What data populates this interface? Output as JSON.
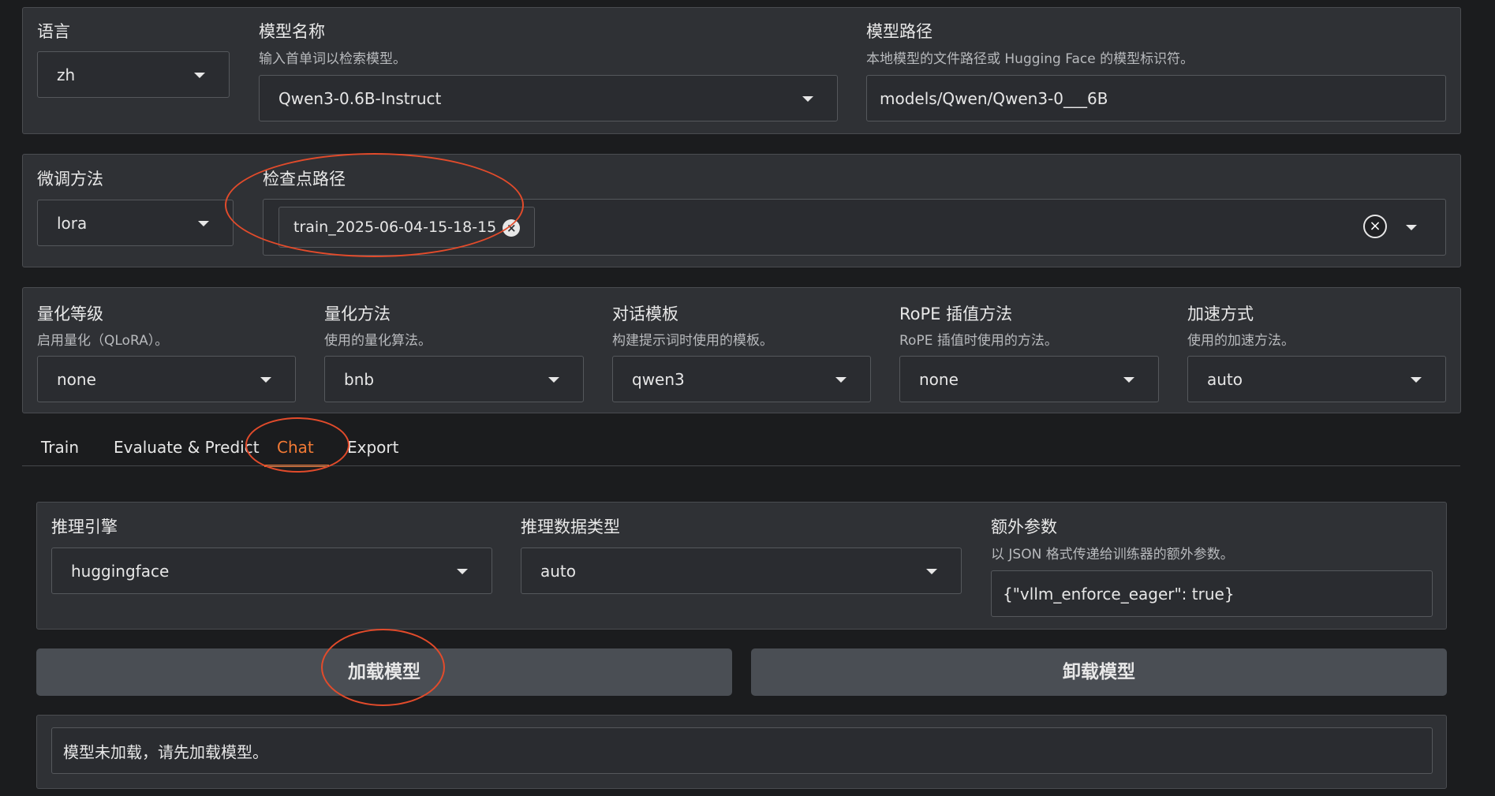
{
  "top": {
    "language": {
      "label": "语言",
      "value": "zh"
    },
    "model_name": {
      "label": "模型名称",
      "info": "输入首单词以检索模型。",
      "value": "Qwen3-0.6B-Instruct"
    },
    "model_path": {
      "label": "模型路径",
      "info": "本地模型的文件路径或 Hugging Face 的模型标识符。",
      "value": "models/Qwen/Qwen3-0___6B"
    }
  },
  "finetune": {
    "method": {
      "label": "微调方法",
      "value": "lora"
    },
    "checkpoint": {
      "label": "检查点路径",
      "chip": "train_2025-06-04-15-18-15",
      "chip_remove": "×",
      "clear_all": "×"
    }
  },
  "quant": {
    "bit": {
      "label": "量化等级",
      "info": "启用量化（QLoRA）。",
      "value": "none"
    },
    "method": {
      "label": "量化方法",
      "info": "使用的量化算法。",
      "value": "bnb"
    },
    "template": {
      "label": "对话模板",
      "info": "构建提示词时使用的模板。",
      "value": "qwen3"
    },
    "rope": {
      "label": "RoPE 插值方法",
      "info": "RoPE 插值时使用的方法。",
      "value": "none"
    },
    "booster": {
      "label": "加速方式",
      "info": "使用的加速方法。",
      "value": "auto"
    }
  },
  "tabs": [
    {
      "label": "Train"
    },
    {
      "label": "Evaluate & Predict"
    },
    {
      "label": "Chat"
    },
    {
      "label": "Export"
    }
  ],
  "chat": {
    "infer_backend": {
      "label": "推理引擎",
      "value": "huggingface"
    },
    "infer_dtype": {
      "label": "推理数据类型",
      "value": "auto"
    },
    "extra_args": {
      "label": "额外参数",
      "info": "以 JSON 格式传递给训练器的额外参数。",
      "value": "{\"vllm_enforce_eager\": true}"
    },
    "load_button": "加载模型",
    "unload_button": "卸载模型",
    "status": "模型未加载，请先加载模型。"
  },
  "colors": {
    "accent": "#f27a35",
    "annotation": "#e24b2b",
    "panel": "#2f3135",
    "background": "#1b1c1e"
  }
}
